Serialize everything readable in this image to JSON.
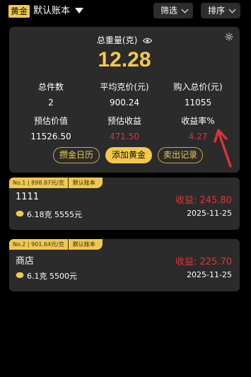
{
  "header": {
    "category_tag": "黄金",
    "book_name": "默认账本",
    "filter_label": "筛选",
    "sort_label": "排序"
  },
  "summary": {
    "weight_label": "总重量(克)",
    "weight_value": "12.28",
    "stats": [
      {
        "label": "总件数",
        "value": "2"
      },
      {
        "label": "平均克价(元)",
        "value": "900.24"
      },
      {
        "label": "购入总价(元)",
        "value": "11055"
      },
      {
        "label": "预估价值",
        "value": "11526.50"
      },
      {
        "label": "预估收益",
        "value": "471.50"
      },
      {
        "label": "收益率%",
        "value": "4.27"
      }
    ],
    "actions": {
      "calendar": "攒金日历",
      "add": "添加黄金",
      "sell": "卖出记录"
    }
  },
  "items": [
    {
      "badge_no": "No.1 | 898.87元/克",
      "badge_book": "默认账本",
      "name": "1111",
      "profit": "收益: 245.80",
      "info": "6.18克 5555元",
      "date": "2025-11-25"
    },
    {
      "badge_no": "No.2 | 901.64元/克",
      "badge_book": "默认账本",
      "name": "商店",
      "profit": "收益: 225.70",
      "info": "6.1克 5500元",
      "date": "2025-11-25"
    }
  ],
  "colors": {
    "accent_gold": "#f2c94c",
    "profit_red": "#e0353b",
    "card_bg": "#2b2b2b"
  }
}
